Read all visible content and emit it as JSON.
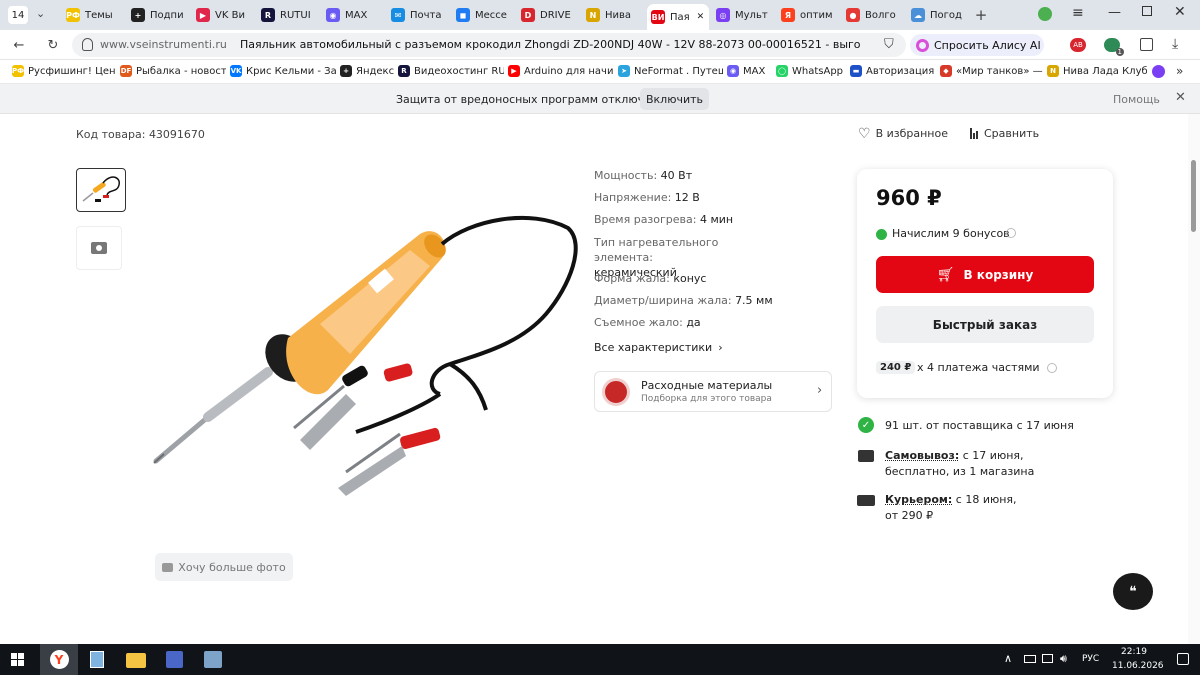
{
  "tabs": {
    "count": "14",
    "items": [
      {
        "label": "Темы",
        "icon": "РФ",
        "color": "#f2c200"
      },
      {
        "label": "Подпи",
        "icon": "+",
        "color": "#222"
      },
      {
        "label": "VK Ви",
        "icon": "▶",
        "color": "#e0264a"
      },
      {
        "label": "RUTUI",
        "icon": "R",
        "color": "#14143c"
      },
      {
        "label": "MAX",
        "icon": "◉",
        "color": "#6a5bf4"
      },
      {
        "label": "Почта",
        "icon": "✉",
        "color": "#168de2"
      },
      {
        "label": "Мессе",
        "icon": "◼",
        "color": "#1f7cf2"
      },
      {
        "label": "DRIVE",
        "icon": "D",
        "color": "#d8262f"
      },
      {
        "label": "Нива",
        "icon": "N",
        "color": "#d9a600"
      },
      {
        "label": "Пая",
        "icon": "ВИ",
        "color": "#e30613"
      },
      {
        "label": "Мульт",
        "icon": "◎",
        "color": "#7a3ff2"
      },
      {
        "label": "оптим",
        "icon": "Я",
        "color": "#fc3f1d"
      },
      {
        "label": "Волго",
        "icon": "●",
        "color": "#e53935"
      },
      {
        "label": "Погод",
        "icon": "☁",
        "color": "#4a90d9"
      }
    ]
  },
  "address": {
    "domain": "www.vseinstrumenti.ru",
    "title": "Паяльник автомобильный с разъемом крокодил Zhongdi ZD-200NDJ 40W - 12V 88-2073 00-00016521 - выго...",
    "alice_label": "Спросить Алису AI",
    "badge_count": "1"
  },
  "bookmarks": [
    {
      "label": "Русфишинг! Цент",
      "icon": "РФ",
      "color": "#f2c200"
    },
    {
      "label": "Рыбалка - новост",
      "icon": "DF",
      "color": "#e05a1c"
    },
    {
      "label": "Крис Кельми - За",
      "icon": "VK",
      "color": "#0077ff"
    },
    {
      "label": "Яндекс",
      "icon": "+",
      "color": "#222"
    },
    {
      "label": "Видеохостинг RU",
      "icon": "R",
      "color": "#14143c"
    },
    {
      "label": "Arduino для начи",
      "icon": "▶",
      "color": "#ff0000"
    },
    {
      "label": "NeFormat . Путеш",
      "icon": "➤",
      "color": "#2aa3df"
    },
    {
      "label": "MAX",
      "icon": "◉",
      "color": "#6a5bf4"
    },
    {
      "label": "WhatsApp",
      "icon": "◯",
      "color": "#25d366"
    },
    {
      "label": "Авторизация",
      "icon": "▬",
      "color": "#1e50c8"
    },
    {
      "label": "«Мир танков» — ",
      "icon": "◆",
      "color": "#d83a2a"
    },
    {
      "label": "Нива Лада Клуб ",
      "icon": "N",
      "color": "#d9a600"
    }
  ],
  "infobar": {
    "message": "Защита от вредоносных программ отключена",
    "enable_label": "Включить",
    "help_label": "Помощь"
  },
  "product": {
    "code_label": "Код товара:",
    "code_value": "43091670",
    "favorite_label": "В избранное",
    "compare_label": "Сравнить",
    "more_photos_label": "Хочу больше фото",
    "specs": [
      {
        "name": "Мощность:",
        "value": "40 Вт"
      },
      {
        "name": "Напряжение:",
        "value": "12 В"
      },
      {
        "name": "Время разогрева:",
        "value": "4 мин"
      },
      {
        "name": "Тип нагревательного элемента:",
        "value": "керамический"
      },
      {
        "name": "Форма жала:",
        "value": "конус"
      },
      {
        "name": "Диаметр/ширина жала:",
        "value": "7.5 мм"
      },
      {
        "name": "Съемное жало:",
        "value": "да"
      }
    ],
    "all_specs_label": "Все характеристики",
    "consumables_title": "Расходные материалы",
    "consumables_subtitle": "Подборка для этого товара"
  },
  "buy": {
    "price": "960 ₽",
    "bonus": "Начислим 9 бонусов",
    "cart_label": "В корзину",
    "quick_order_label": "Быстрый заказ",
    "installment_amount": "240 ₽",
    "installment_text": "х 4 платежа частями"
  },
  "delivery": {
    "stock": "91 шт. от поставщика с 17 июня",
    "pickup_title": "Самовывоз:",
    "pickup_rest": " с 17 июня,",
    "pickup_line2": "бесплатно, из 1 магазина",
    "courier_title": "Курьером:",
    "courier_rest": " с 18 июня,",
    "courier_line2": "от 290 ₽"
  },
  "taskbar": {
    "lang": "РУС",
    "time": "22:19",
    "date": "11.06.2026"
  },
  "colors": {
    "accent_red": "#e30613",
    "green": "#2fb344"
  }
}
